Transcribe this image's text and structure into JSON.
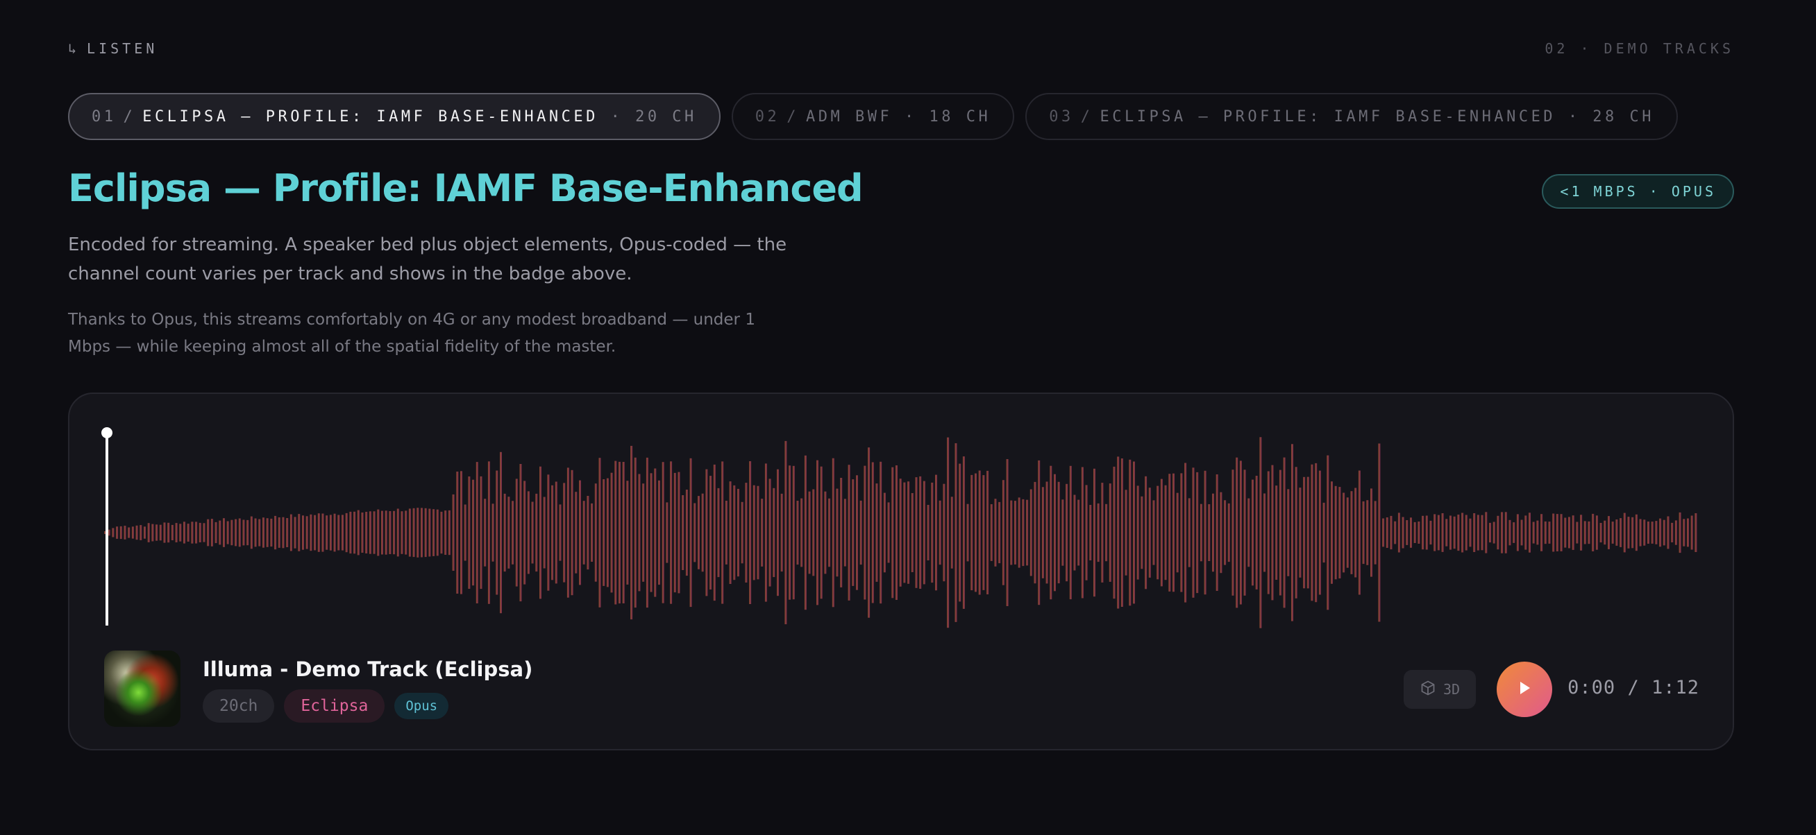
{
  "header": {
    "eyebrow_icon": "↳",
    "eyebrow": "LISTEN",
    "count": "02 · DEMO TRACKS"
  },
  "tabs": [
    {
      "num": "01",
      "sep": "/",
      "label": "ECLIPSA — PROFILE: IAMF BASE-ENHANCED",
      "channels": "· 20 CH",
      "active": true
    },
    {
      "num": "02",
      "sep": "/",
      "label": "ADM BWF",
      "channels": "· 18 CH",
      "active": false
    },
    {
      "num": "03",
      "sep": "/",
      "label": "ECLIPSA — PROFILE: IAMF BASE-ENHANCED",
      "channels": "· 28 CH",
      "active": false
    }
  ],
  "main": {
    "title": "Eclipsa — Profile: IAMF Base-Enhanced",
    "badge": "<1 MBPS · OPUS",
    "description": "Encoded for streaming. A speaker bed plus object elements, Opus-coded — the channel count varies per track and shows in the badge above.",
    "note": "Thanks to Opus, this streams comfortably on 4G or any modest broadband — under 1 Mbps — while keeping almost all of the spatial fidelity of the master."
  },
  "player": {
    "track_title": "Illuma - Demo Track (Eclipsa)",
    "chips": {
      "channels": "20ch",
      "format": "Eclipsa",
      "codec": "Opus"
    },
    "btn_3d": "3D",
    "time_current": "0:00",
    "time_sep": "/",
    "time_total": "1:12",
    "progress": 0,
    "colors": {
      "wave_start": "#8a4a2c",
      "wave_end": "#7a2c50",
      "play_start": "#f08a3a",
      "play_end": "#e05a8c"
    }
  },
  "icons": {
    "play": "play-icon",
    "cube": "cube-icon",
    "artwork": "album-art"
  }
}
